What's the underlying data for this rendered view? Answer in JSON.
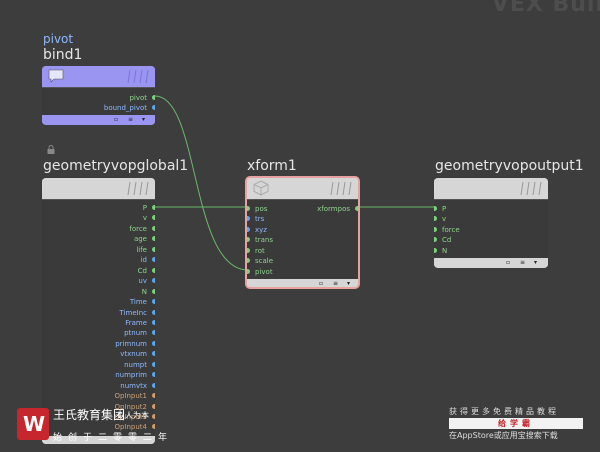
{
  "watermark": {
    "title": "VEX Buil"
  },
  "nodes": {
    "bind1": {
      "subtitle": "pivot",
      "name": "bind1",
      "outputs": [
        "pivot",
        "bound_pivot"
      ]
    },
    "global": {
      "name": "geometryvopglobal1",
      "outputs": [
        "P",
        "v",
        "force",
        "age",
        "life",
        "id",
        "Cd",
        "uv",
        "N",
        "Time",
        "TimeInc",
        "Frame",
        "ptnum",
        "primnum",
        "vtxnum",
        "numpt",
        "numprim",
        "numvtx",
        "OpInput1",
        "OpInput2",
        "OpInput3",
        "OpInput4"
      ]
    },
    "xform": {
      "name": "xform1",
      "inputs": [
        "pos",
        "trs",
        "xyz",
        "trans",
        "rot",
        "scale",
        "pivot"
      ],
      "outputs": [
        "xformpos"
      ]
    },
    "output": {
      "name": "geometryvopoutput1",
      "inputs": [
        "P",
        "v",
        "force",
        "Cd",
        "N"
      ]
    }
  },
  "footer_buttons": [
    "▫",
    "≡",
    "▾"
  ],
  "branding": {
    "logo_letter": "W",
    "company": "王氏教育集团",
    "slogan": "始创于二零零二年",
    "tagline": "以人为本"
  },
  "promo": {
    "line1": "获得更多免费精品教程",
    "bar": "给学霸",
    "appstore": "在AppStore或应用宝搜索下载"
  },
  "colors": {
    "canvas": "#3d3d3d",
    "bind_header": "#9b95f2",
    "node_header": "#d6d6d6",
    "node_body": "#3a3a3a",
    "wire": "#6ab86a",
    "port_green": "#7cd27c",
    "port_blue": "#5aa8f0",
    "port_orange": "#d59c6a",
    "label_blue": "#8fb8ff",
    "label_green": "#8fd28f"
  }
}
